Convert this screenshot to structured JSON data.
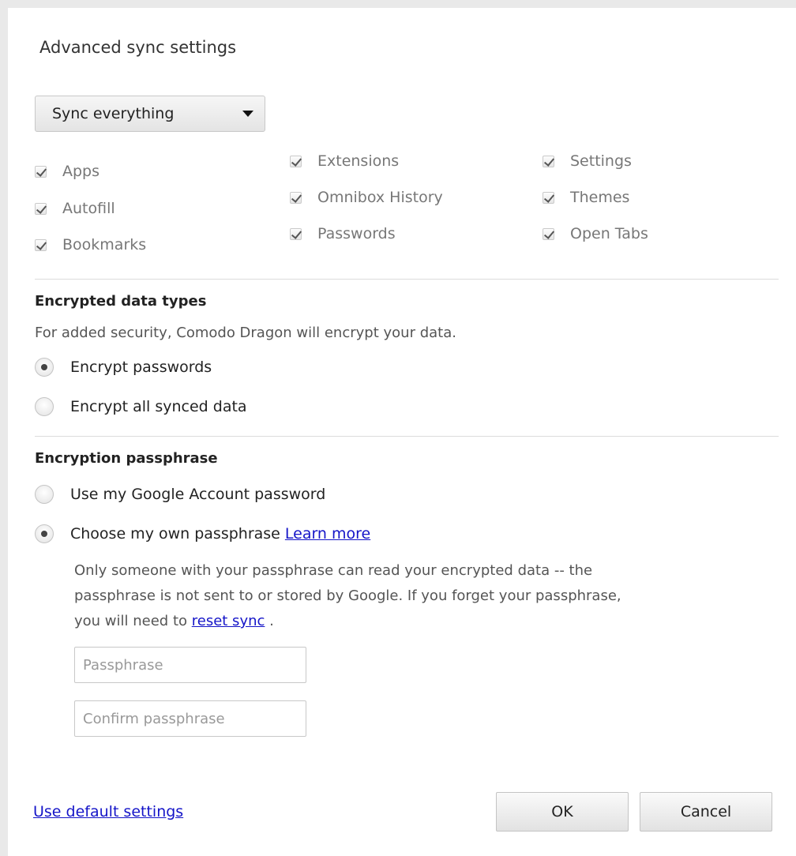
{
  "dialog": {
    "title": "Advanced sync settings"
  },
  "sync_mode": {
    "selected": "Sync everything"
  },
  "data_types": [
    {
      "label": "Apps",
      "checked": true
    },
    {
      "label": "Autofill",
      "checked": true
    },
    {
      "label": "Bookmarks",
      "checked": true
    },
    {
      "label": "Extensions",
      "checked": true
    },
    {
      "label": "Omnibox History",
      "checked": true
    },
    {
      "label": "Passwords",
      "checked": true
    },
    {
      "label": "Settings",
      "checked": true
    },
    {
      "label": "Themes",
      "checked": true
    },
    {
      "label": "Open Tabs",
      "checked": true
    }
  ],
  "encrypted": {
    "heading": "Encrypted data types",
    "description": "For added security, Comodo Dragon will encrypt your data.",
    "options": [
      {
        "label": "Encrypt passwords",
        "checked": true
      },
      {
        "label": "Encrypt all synced data",
        "checked": false
      }
    ]
  },
  "passphrase": {
    "heading": "Encryption passphrase",
    "option_google": "Use my Google Account password",
    "option_own": "Choose my own passphrase",
    "learn_more": "Learn more",
    "info_line1": "Only someone with your passphrase can read your encrypted data -- the",
    "info_line2": "passphrase is not sent to or stored by Google. If you forget your passphrase,",
    "info_line3_prefix": "you will need to",
    "reset_sync": "reset sync",
    "info_line3_suffix": ".",
    "placeholder": "Passphrase",
    "confirm_placeholder": "Confirm passphrase"
  },
  "footer": {
    "default_link": "Use default settings",
    "ok": "OK",
    "cancel": "Cancel"
  }
}
